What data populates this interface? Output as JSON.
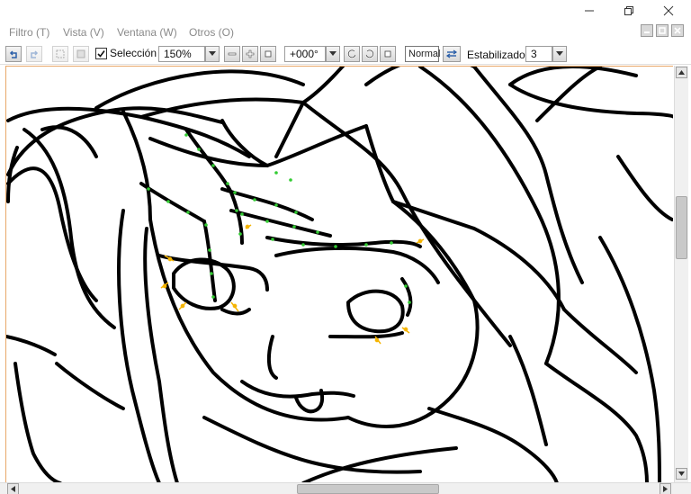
{
  "window": {
    "minimize_icon": "minimize-icon",
    "restore_icon": "restore-icon",
    "close_icon": "close-icon"
  },
  "menu": {
    "items": [
      {
        "label": "Filtro (T)"
      },
      {
        "label": "Vista (V)"
      },
      {
        "label": "Ventana (W)"
      },
      {
        "label": "Otros (O)"
      }
    ]
  },
  "toolbar": {
    "selection_label": "Selección",
    "selection_checked": true,
    "zoom_value": "150%",
    "rotation_value": "+000°",
    "blend_mode": "Normal",
    "stabilizer_label": "Estabilizador",
    "stabilizer_value": "3"
  },
  "colors": {
    "canvas_border": "#e9a86a",
    "ink": "#000000",
    "vector_points": "#33cc33",
    "control_points": "#f5b400"
  },
  "scroll": {
    "vertical_position": 0.33,
    "horizontal_position": 0.44
  }
}
